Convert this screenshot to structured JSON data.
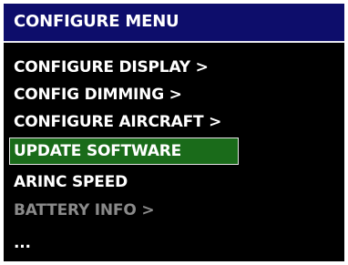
{
  "header": {
    "title": "CONFIGURE MENU"
  },
  "menu": {
    "items": [
      {
        "label": "CONFIGURE DISPLAY >",
        "state": "normal"
      },
      {
        "label": "CONFIG DIMMING >",
        "state": "normal"
      },
      {
        "label": "CONFIGURE AIRCRAFT >",
        "state": "normal"
      },
      {
        "label": "UPDATE SOFTWARE",
        "state": "selected"
      },
      {
        "label": "ARINC SPEED",
        "state": "normal"
      },
      {
        "label": "BATTERY INFO >",
        "state": "disabled"
      },
      {
        "label": "...",
        "state": "normal"
      }
    ]
  },
  "colors": {
    "title_bar": "#0d0d6b",
    "screen_background": "#000000",
    "selected_highlight": "#1a6b1a",
    "text": "#ffffff",
    "disabled_text": "#8a8a8a"
  }
}
